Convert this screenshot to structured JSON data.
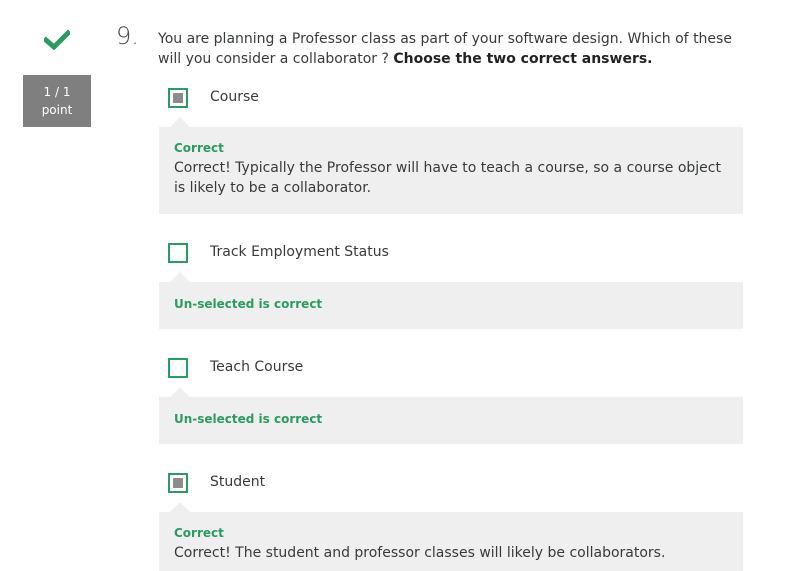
{
  "status": {
    "icon": "checkmark-icon",
    "color": "#2a9c61"
  },
  "score": {
    "value": "1 / 1",
    "unit": "point"
  },
  "question": {
    "number": "9.",
    "text": "You are planning a Professor class as part of your software design. Which of these will you consider a collaborator ? ",
    "instruction": "Choose the two correct answers."
  },
  "options": [
    {
      "label": "Course",
      "checked": true,
      "feedback_title": "Correct",
      "feedback_text": "Correct! Typically the Professor will have to teach a course, so a course object is likely to be a collaborator."
    },
    {
      "label": "Track Employment Status",
      "checked": false,
      "feedback_title": "Un-selected is correct",
      "feedback_text": ""
    },
    {
      "label": "Teach Course",
      "checked": false,
      "feedback_title": "Un-selected is correct",
      "feedback_text": ""
    },
    {
      "label": "Student",
      "checked": true,
      "feedback_title": "Correct",
      "feedback_text": "Correct! The student and professor classes will likely be collaborators."
    }
  ]
}
